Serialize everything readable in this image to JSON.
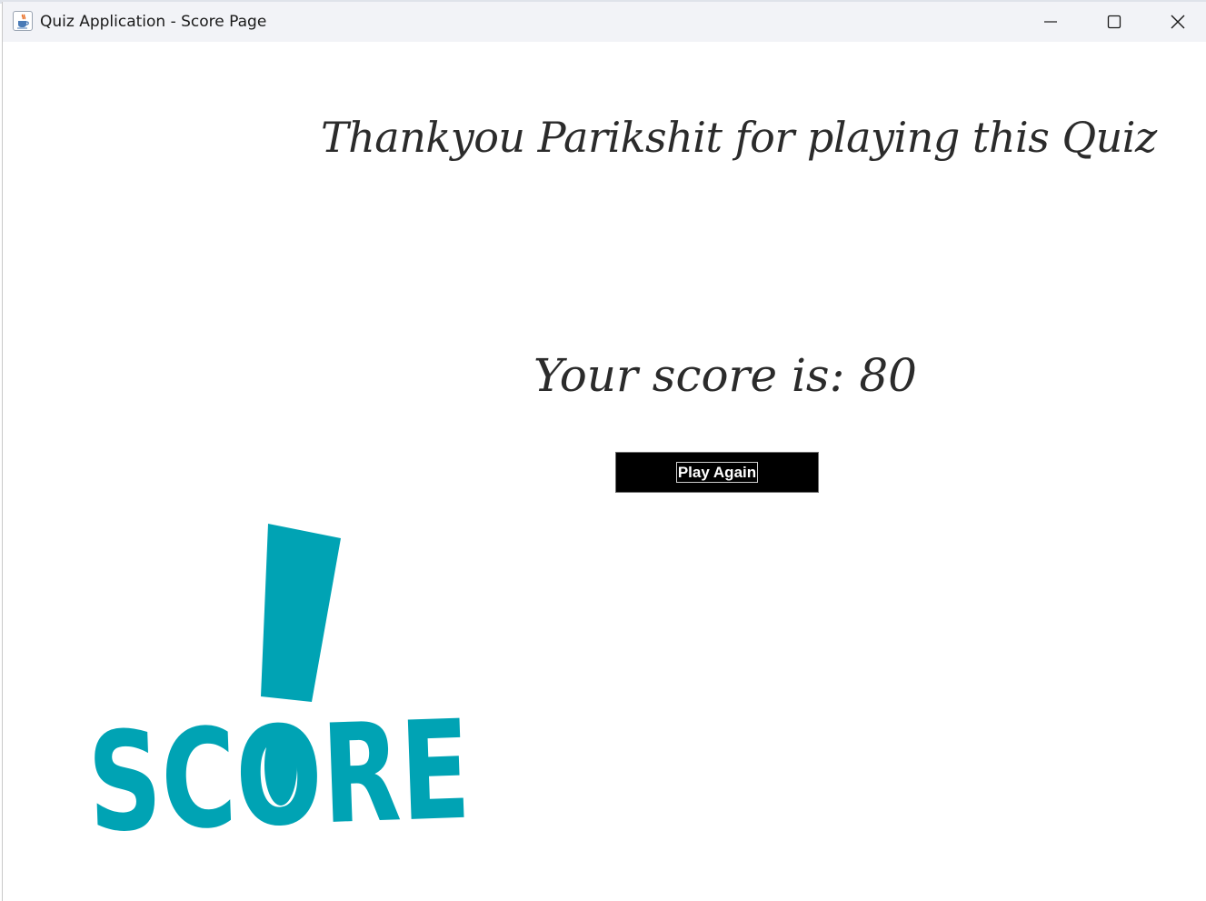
{
  "window": {
    "title": "Quiz Application - Score Page",
    "app_icon": "java-cup-icon",
    "controls": {
      "minimize_icon": "minimize-icon",
      "maximize_icon": "maximize-icon",
      "close_icon": "close-icon"
    }
  },
  "score_page": {
    "thanks_message": "Thankyou Parikshit for playing this Quiz",
    "score_text": "Your score is: 80",
    "play_again_label": "Play Again"
  },
  "logo": {
    "text": "SCORE",
    "icon": "score-exclamation-logo",
    "color": "#00a3b4"
  },
  "colors": {
    "title_bar": "#f2f3f7",
    "text": "#2b2b2b",
    "button_bg": "#000000",
    "button_text": "#ffffff"
  }
}
